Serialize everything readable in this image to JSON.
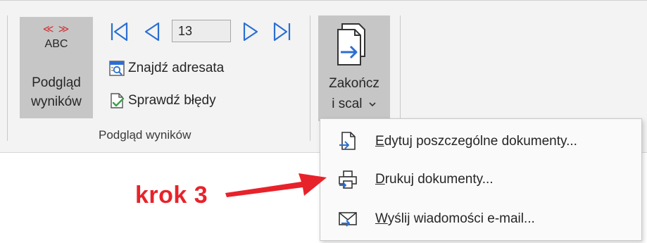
{
  "ribbon": {
    "preview_results_button": {
      "label": "Podgląd wyników",
      "icon_text": "ABC",
      "icon": "preview-results-icon"
    },
    "navigation": {
      "record_number": "13",
      "first_icon": "first-record-icon",
      "previous_icon": "previous-record-icon",
      "next_icon": "next-record-icon",
      "last_icon": "last-record-icon"
    },
    "find_recipient": {
      "label": "Znajdź adresata",
      "icon": "find-recipient-icon"
    },
    "check_errors": {
      "label": "Sprawdź błędy",
      "icon": "check-errors-icon"
    },
    "group_label": "Podgląd wyników",
    "finish_button": {
      "label_line1": "Zakończ",
      "label_line2": "i scal",
      "icon": "finish-merge-icon",
      "dropdown_icon": "chevron-down-icon"
    }
  },
  "menu": {
    "items": [
      {
        "accel": "E",
        "rest": "dytuj poszczególne dokumenty...",
        "icon": "edit-documents-icon"
      },
      {
        "accel": "D",
        "rest": "rukuj dokumenty...",
        "icon": "printer-icon"
      },
      {
        "accel": "W",
        "rest": "yślij wiadomości e-mail...",
        "icon": "email-icon"
      }
    ]
  },
  "annotation": {
    "text": "krok 3",
    "color": "#e8222a"
  },
  "colors": {
    "accent_blue": "#2b6fd1",
    "ribbon_bg": "#f3f3f3",
    "pressed_bg": "#c6c6c6"
  }
}
